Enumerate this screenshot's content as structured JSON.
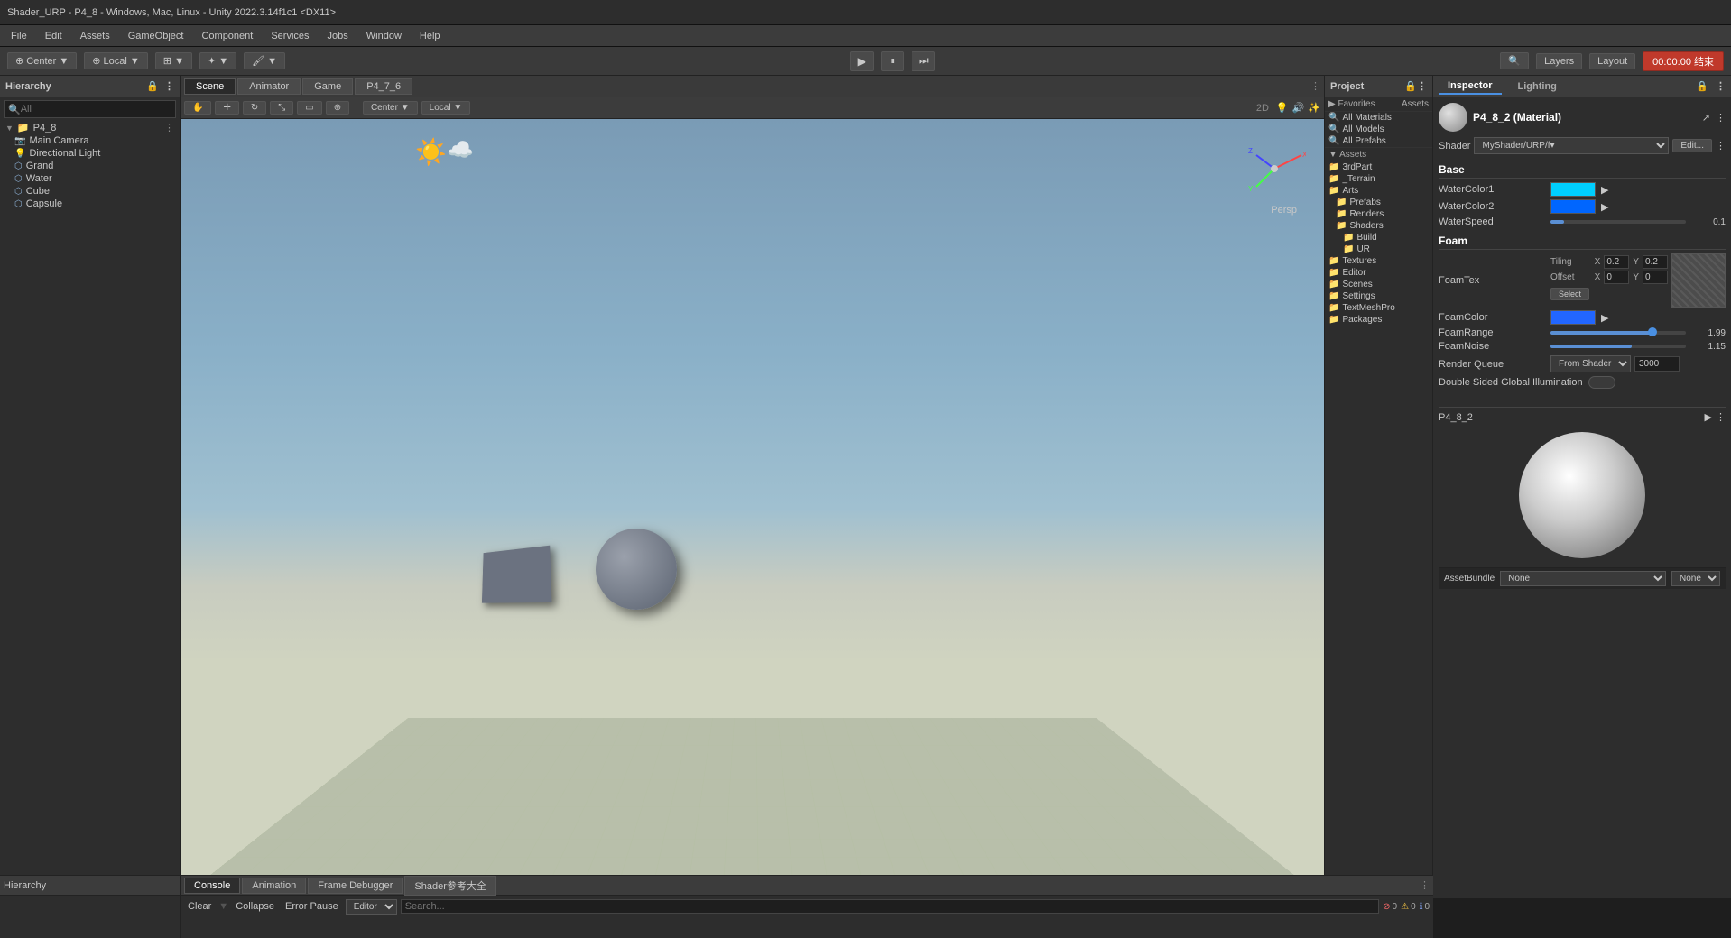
{
  "title_bar": {
    "text": "Shader_URP - P4_8 - Windows, Mac, Linux - Unity 2022.3.14f1c1 <DX11>"
  },
  "menu": {
    "items": [
      "File",
      "Edit",
      "Assets",
      "GameObject",
      "Component",
      "Services",
      "Jobs",
      "Window",
      "Help"
    ]
  },
  "toolbar": {
    "pivot_label": "Center",
    "space_label": "Local",
    "play_icon": "▶",
    "pause_icon": "⏸",
    "step_icon": "⏭",
    "layers_label": "Layers",
    "layout_label": "Layout",
    "timer_label": "00:00:00 结束"
  },
  "panels": {
    "hierarchy": {
      "title": "Hierarchy",
      "search_placeholder": "All",
      "root": "P4_8",
      "items": [
        {
          "name": "Main Camera",
          "indent": 1,
          "type": "camera"
        },
        {
          "name": "Directional Light",
          "indent": 1,
          "type": "light"
        },
        {
          "name": "Grand",
          "indent": 1,
          "type": "object"
        },
        {
          "name": "Water",
          "indent": 1,
          "type": "object"
        },
        {
          "name": "Cube",
          "indent": 1,
          "type": "object"
        },
        {
          "name": "Capsule",
          "indent": 1,
          "type": "object"
        }
      ]
    },
    "scene": {
      "tabs": [
        "Scene",
        "Animator",
        "Game",
        "P4_7_6"
      ],
      "active_tab": "Scene",
      "toolbar_items": [
        "Center ▼",
        "Local ▼",
        "⊞ ▼",
        "☰ ▼",
        "⚙ ▼"
      ],
      "persp_label": "Persp",
      "view_mode": "2D"
    },
    "project": {
      "title": "Project",
      "favorites": {
        "label": "Favorites",
        "items": [
          "All Materials",
          "All Models",
          "All Prefabs"
        ]
      },
      "assets_label": "Assets",
      "asset_items": [
        "3rdPart",
        "_Terrain",
        "Arts",
        "Prefabs",
        "Renders",
        "Shaders",
        "Build",
        "UR",
        "Textures",
        "Editor",
        "Scenes",
        "Settings",
        "TextMeshPro",
        "Packages"
      ]
    },
    "inspector": {
      "title": "Inspector",
      "lighting_tab": "Lighting",
      "material_name": "P4_8_2 (Material)",
      "shader_label": "Shader",
      "shader_value": "MyShader/URP/f▾",
      "edit_button": "Edit...",
      "sections": {
        "base": {
          "label": "Base",
          "water_color1_label": "WaterColor1",
          "water_color1_value": "cyan",
          "water_color2_label": "WaterColor2",
          "water_color2_value": "blue",
          "water_speed_label": "WaterSpeed",
          "water_speed_value": "0.1",
          "water_speed_slider": 10
        },
        "foam": {
          "label": "Foam",
          "foam_tex_label": "FoamTex",
          "tiling_label": "Tiling",
          "tiling_x": "0.2",
          "tiling_y": "0.2",
          "offset_label": "Offset",
          "offset_x": "0",
          "offset_y": "0",
          "select_btn": "Select",
          "foam_color_label": "FoamColor",
          "foam_color_value": "blue",
          "foam_range_label": "FoamRange",
          "foam_range_value": "1.99",
          "foam_range_slider": 75,
          "foam_noise_label": "FoamNoise",
          "foam_noise_value": "1.15",
          "foam_noise_slider": 60
        },
        "render": {
          "render_queue_label": "Render Queue",
          "render_queue_type": "From Shader",
          "render_queue_value": "3000",
          "double_sided_label": "Double Sided Global Illumination"
        }
      },
      "preview": {
        "material_label": "P4_8_2"
      },
      "asset_bundle": {
        "label": "AssetBundle",
        "value1": "None",
        "value2": "None"
      }
    }
  },
  "console": {
    "tabs": [
      "Console",
      "Animation",
      "Frame Debugger",
      "Shader参考大全"
    ],
    "active_tab": "Console",
    "clear_label": "Clear",
    "collapse_label": "Collapse",
    "error_pause_label": "Error Pause",
    "editor_label": "Editor",
    "error_count": "0",
    "warning_count": "0",
    "info_count": "0"
  }
}
